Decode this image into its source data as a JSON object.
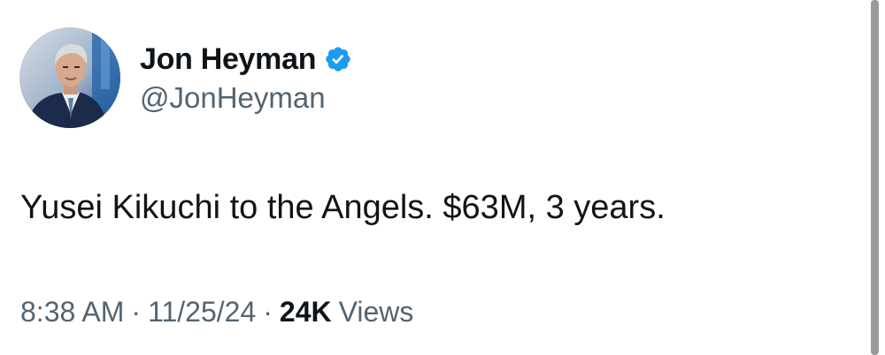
{
  "author": {
    "display_name": "Jon Heyman",
    "handle": "@JonHeyman",
    "verified": true,
    "avatar_icon": "profile-photo"
  },
  "tweet": {
    "text": "Yusei Kikuchi to the Angels. $63M, 3 years."
  },
  "meta": {
    "time": "8:38 AM",
    "separator": "·",
    "date": "11/25/24",
    "views_count": "24K",
    "views_label": "Views"
  },
  "colors": {
    "primary_text": "#0f1419",
    "secondary_text": "#536471",
    "verified_badge": "#1d9bf0"
  }
}
